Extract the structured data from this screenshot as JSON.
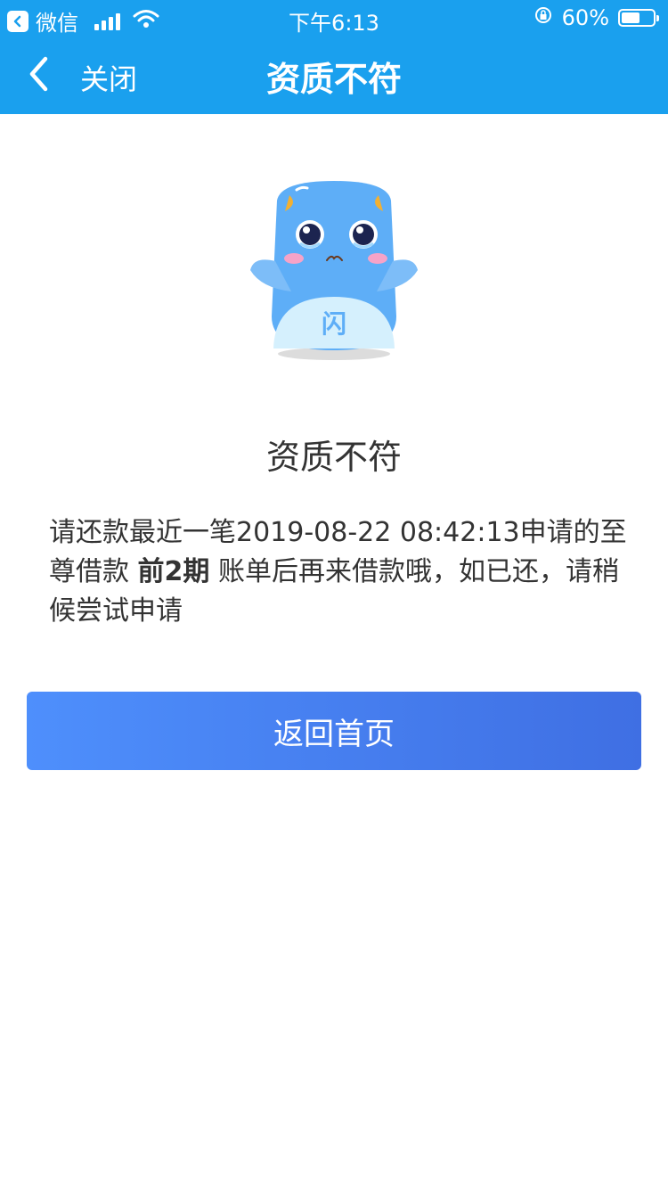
{
  "status_bar": {
    "app_name": "微信",
    "time": "下午6:13",
    "battery_percent": "60%",
    "battery_level": 0.6
  },
  "nav": {
    "close_label": "关闭",
    "title": "资质不符"
  },
  "result": {
    "mascot_badge": "闪",
    "title": "资质不符",
    "message_prefix": "请还款最近一笔2019-08-22 08:42:13申请的至尊借款 ",
    "message_bold": "前2期",
    "message_suffix": " 账单后再来借款哦，如已还，请稍候尝试申请"
  },
  "actions": {
    "home_button_label": "返回首页"
  },
  "colors": {
    "header": "#1aa0ee",
    "button_start": "#4e8ffc",
    "button_end": "#3f6fe3",
    "mascot_body": "#5eaef7"
  }
}
